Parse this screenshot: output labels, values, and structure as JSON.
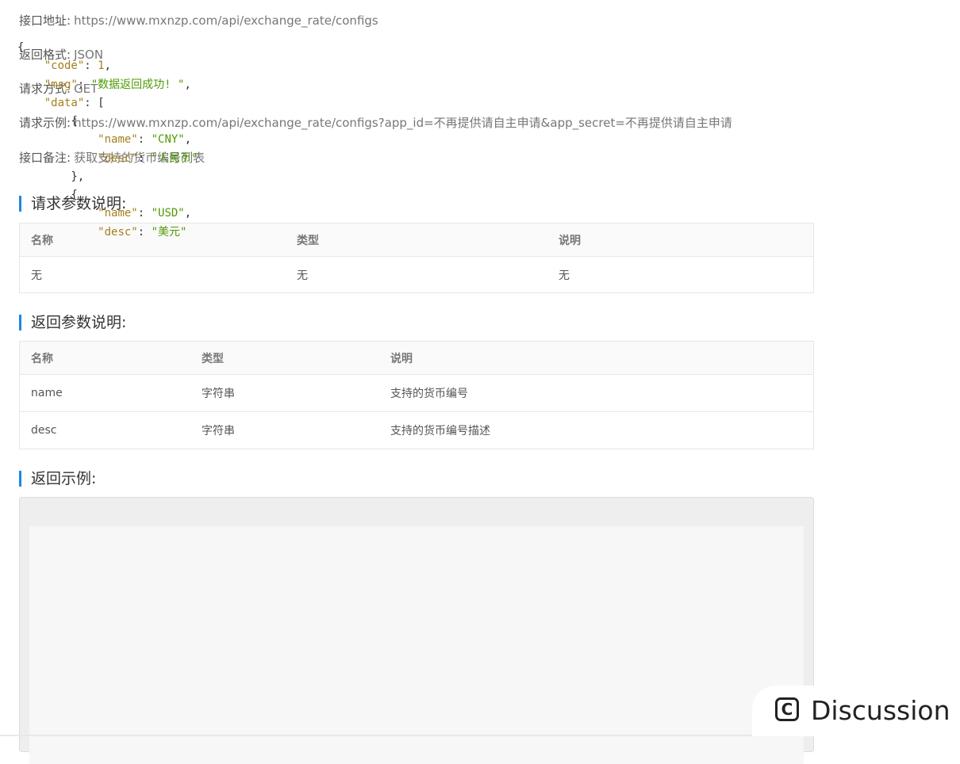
{
  "info": [
    {
      "label": "接口地址:",
      "value": "https://www.mxnzp.com/api/exchange_rate/configs"
    },
    {
      "label": "返回格式:",
      "value": "JSON"
    },
    {
      "label": "请求方式:",
      "value": "GET"
    },
    {
      "label": "请求示例:",
      "value": "https://www.mxnzp.com/api/exchange_rate/configs?app_id=不再提供请自主申请&app_secret=不再提供请自主申请"
    },
    {
      "label": "接口备注:",
      "value": "获取支持的货币编号列表"
    }
  ],
  "request_params": {
    "title": "请求参数说明:",
    "headers": [
      "名称",
      "类型",
      "说明"
    ],
    "rows": [
      [
        "无",
        "无",
        "无"
      ]
    ]
  },
  "response_params": {
    "title": "返回参数说明:",
    "headers": [
      "名称",
      "类型",
      "说明"
    ],
    "rows": [
      [
        "name",
        "字符串",
        "支持的货币编号"
      ],
      [
        "desc",
        "字符串",
        "支持的货币编号描述"
      ]
    ]
  },
  "example": {
    "title": "返回示例:",
    "code_lines": [
      "{",
      "    \"code\": 1,",
      "    \"msg\": \"数据返回成功! \",",
      "    \"data\": [",
      "        {",
      "            \"name\": \"CNY\",",
      "            \"desc\": \"人民币\"",
      "        },",
      "        {",
      "            \"name\": \"USD\",",
      "            \"desc\": \"美元\""
    ]
  },
  "discussion": {
    "icon": "C",
    "label": "Discussion"
  },
  "colors": {
    "accent": "#1e88e5",
    "string": "#4e9a06",
    "key": "#a67f1b"
  }
}
